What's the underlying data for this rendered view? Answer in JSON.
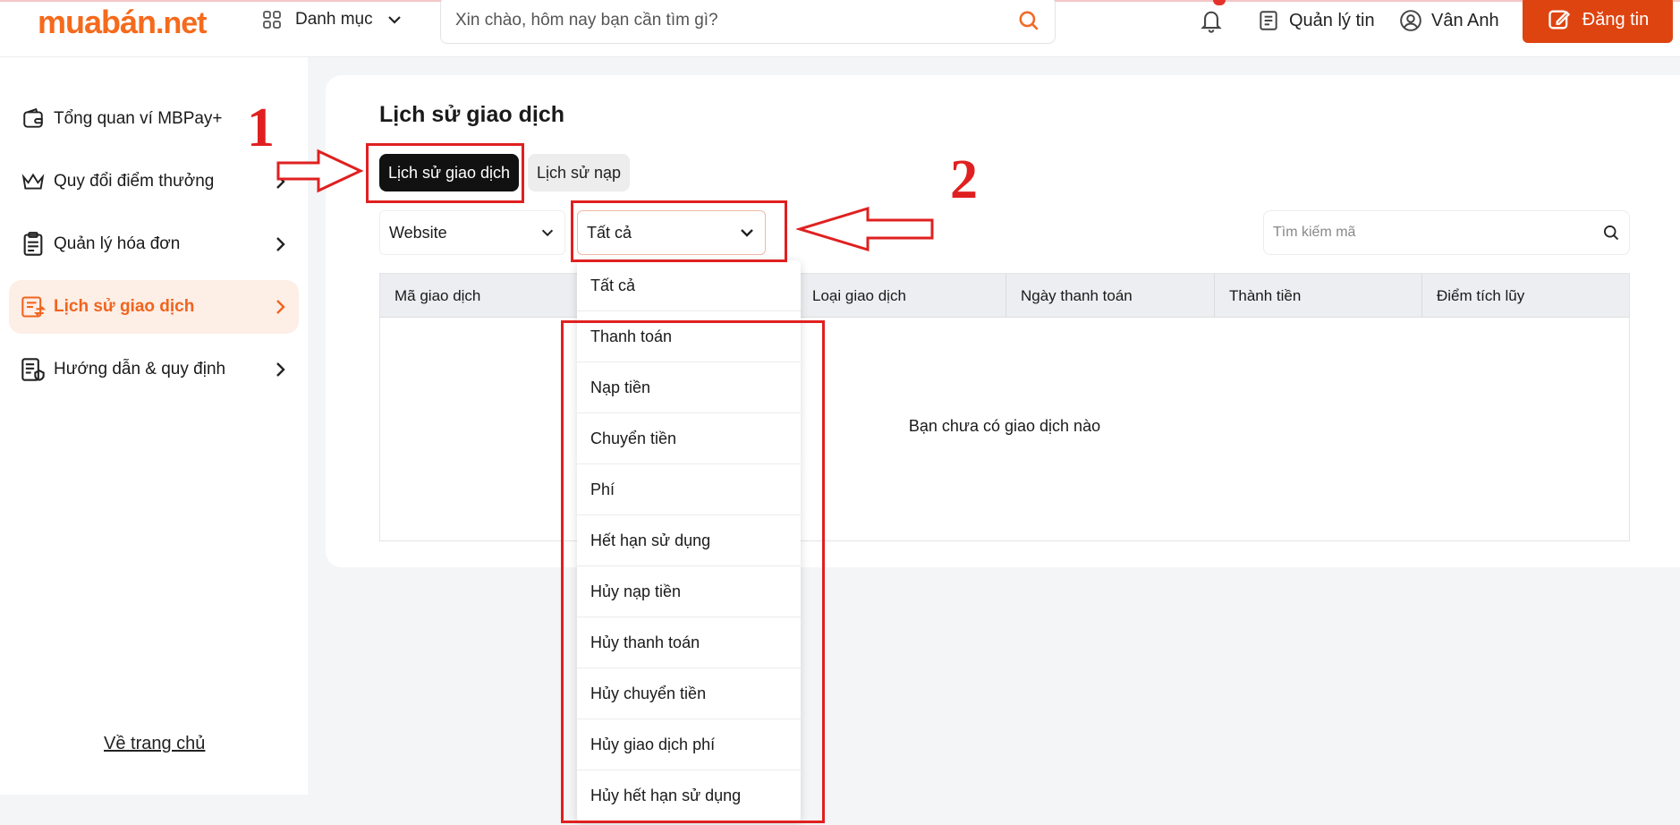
{
  "header": {
    "logo_main": "muabán",
    "logo_suffix": ".net",
    "category_label": "Danh mục",
    "search_placeholder": "Xin chào, hôm nay bạn cần tìm gì?",
    "manage_label": "Quản lý tin",
    "user_name": "Vân Anh",
    "post_label": "Đăng tin",
    "accent_color": "#de4410",
    "icons": [
      "grid-icon",
      "chevron-down-icon",
      "search-icon",
      "bell-icon",
      "document-icon",
      "user-circle-icon",
      "edit-icon"
    ]
  },
  "sidebar": {
    "items": [
      {
        "label": "Tổng quan ví MBPay+",
        "icon": "wallet-icon",
        "active": false,
        "has_arrow": false
      },
      {
        "label": "Quy đổi điểm thưởng",
        "icon": "crown-icon",
        "active": false,
        "has_arrow": true
      },
      {
        "label": "Quản lý hóa đơn",
        "icon": "clipboard-icon",
        "active": false,
        "has_arrow": true
      },
      {
        "label": "Lịch sử giao dịch",
        "icon": "history-icon",
        "active": true,
        "has_arrow": true
      },
      {
        "label": "Hướng dẫn & quy định",
        "icon": "guide-icon",
        "active": false,
        "has_arrow": true
      }
    ],
    "home_link": "Về trang chủ"
  },
  "main": {
    "title": "Lịch sử giao dịch",
    "tabs": [
      {
        "label": "Lịch sử giao dịch",
        "active": true
      },
      {
        "label": "Lịch sử nạp",
        "active": false
      }
    ],
    "filters": {
      "website_value": "Website",
      "type_value": "Tất cả",
      "search_placeholder": "Tìm kiếm mã"
    },
    "table": {
      "columns": [
        "Mã giao dịch",
        "Loại giao dịch",
        "Ngày thanh toán",
        "Thành tiền",
        "Điểm tích lũy"
      ],
      "empty_text": "Bạn chưa có giao dịch nào"
    },
    "dropdown_options": [
      "Tất cả",
      "Thanh toán",
      "Nạp tiền",
      "Chuyển tiền",
      "Phí",
      "Hết hạn sử dụng",
      "Hủy nạp tiền",
      "Hủy thanh toán",
      "Hủy chuyển tiền",
      "Hủy giao dịch phí",
      "Hủy hết hạn sử dụng"
    ]
  },
  "annotations": {
    "marker_1": "1",
    "marker_2": "2",
    "annotation_color": "#e02020"
  }
}
